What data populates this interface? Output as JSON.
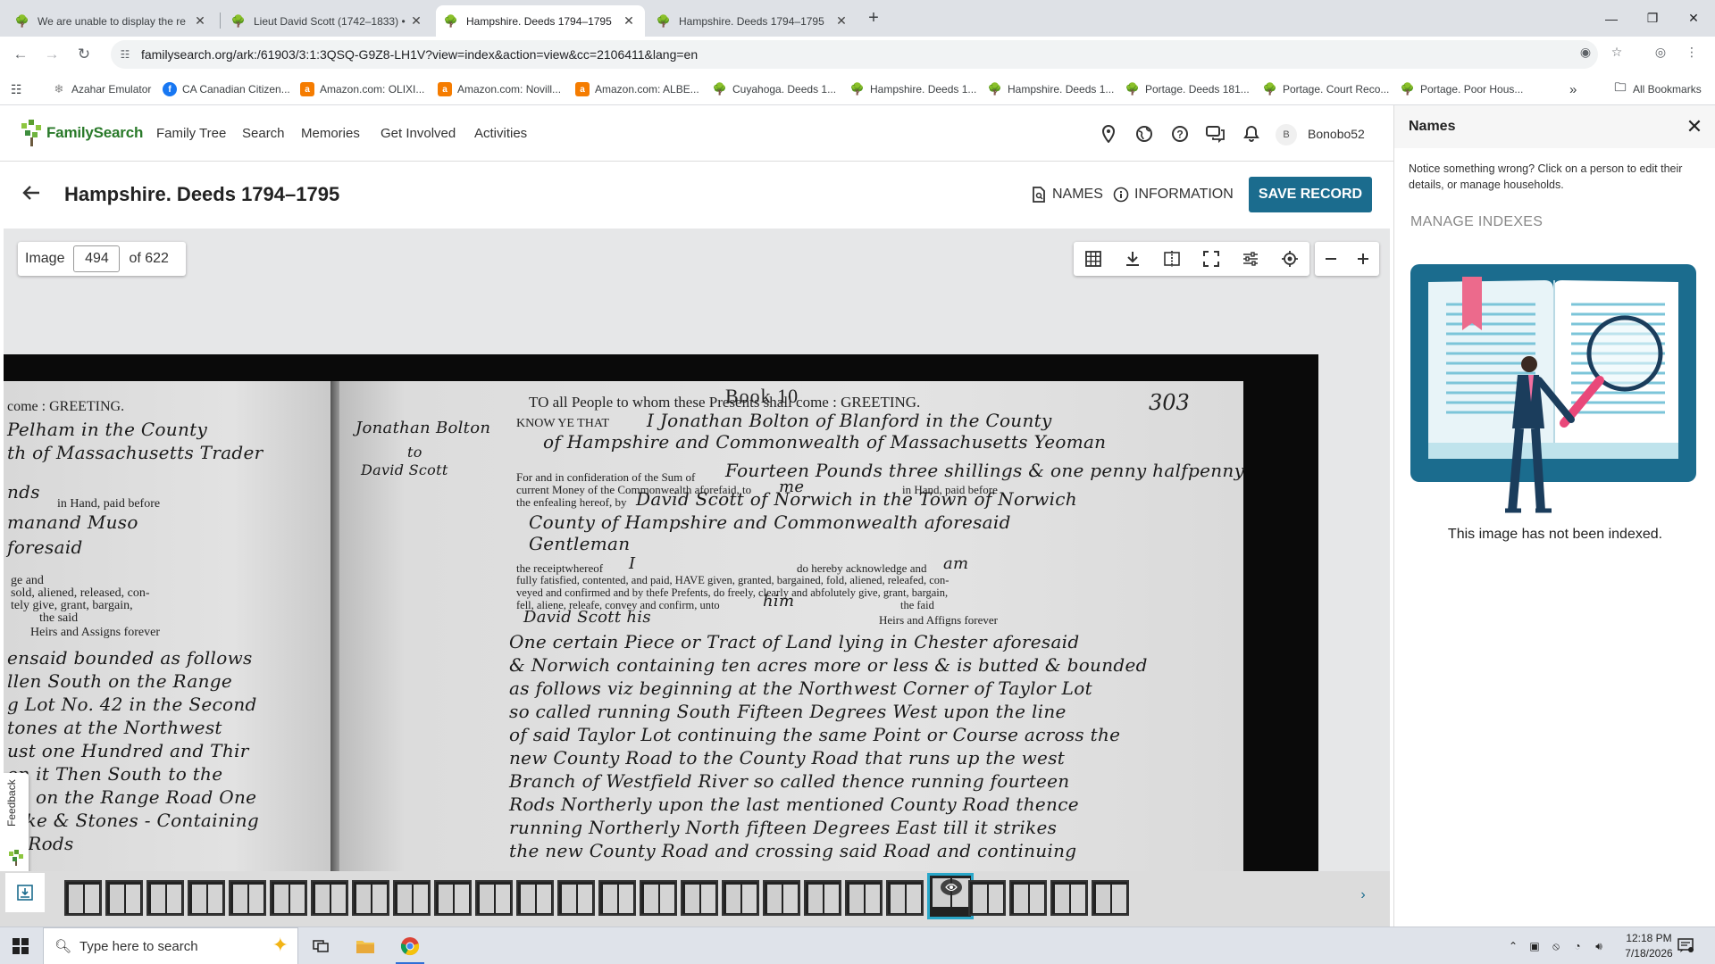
{
  "browser": {
    "tabs": [
      {
        "title": "We are unable to display the re"
      },
      {
        "title": "Lieut David Scott (1742–1833) •"
      },
      {
        "title": "Hampshire. Deeds 1794–1795"
      },
      {
        "title": "Hampshire. Deeds 1794–1795"
      }
    ],
    "url": "familysearch.org/ark:/61903/3:1:3QSQ-G9Z8-LH1V?view=index&action=view&cc=2106411&lang=en",
    "bookmarks": [
      {
        "label": "Azahar Emulator",
        "icon": "azahar-icon"
      },
      {
        "label": "CA Canadian Citizen...",
        "icon": "facebook-icon"
      },
      {
        "label": "Amazon.com: OLIXI...",
        "icon": "amazon-icon"
      },
      {
        "label": "Amazon.com: Novill...",
        "icon": "amazon-icon"
      },
      {
        "label": "Amazon.com: ALBE...",
        "icon": "amazon-icon"
      },
      {
        "label": "Cuyahoga. Deeds 1...",
        "icon": "familysearch-icon"
      },
      {
        "label": "Hampshire. Deeds 1...",
        "icon": "familysearch-icon"
      },
      {
        "label": "Hampshire. Deeds 1...",
        "icon": "familysearch-icon"
      },
      {
        "label": "Portage. Deeds 181...",
        "icon": "familysearch-icon"
      },
      {
        "label": "Portage. Court Reco...",
        "icon": "familysearch-icon"
      },
      {
        "label": "Portage. Poor Hous...",
        "icon": "familysearch-icon"
      }
    ],
    "all_bookmarks": "All Bookmarks",
    "overflow": "»"
  },
  "site": {
    "logo_text": "FamilySearch",
    "nav": [
      "Family Tree",
      "Search",
      "Memories",
      "Get Involved",
      "Activities"
    ],
    "avatar_initial": "B",
    "username": "Bonobo52"
  },
  "record": {
    "title": "Hampshire. Deeds 1794–1795",
    "names_label": "NAMES",
    "information_label": "INFORMATION",
    "save_label": "SAVE RECORD"
  },
  "viewer": {
    "image_label": "Image",
    "image_number": "494",
    "of_total": "of 622",
    "feedback_label": "Feedback",
    "tools": [
      "grid-icon",
      "download-icon",
      "compare-icon",
      "fullscreen-icon",
      "adjust-icon",
      "locate-icon",
      "zoom-out-icon",
      "zoom-in-icon"
    ]
  },
  "document": {
    "book": "Book 10",
    "page_number": "303",
    "left_page": [
      "come : GREETING.",
      "Pelham in the County",
      "th of Massachusetts Trader",
      "nds",
      "in Hand, paid before",
      "manand Muso",
      "foresaid",
      "ge and",
      "sold, aliened, released, con-",
      "tely give, grant, bargain,",
      "the said",
      "Heirs and Assigns forever",
      "ensaid bounded as follows",
      "llen South on the Range",
      "g Lot No. 42 in the Second",
      "tones at the Northwest",
      "ust one Hundred and Thir",
      "on it Then South to the",
      "en on the Range Road One",
      "take & Stones - Containing",
      "rl Rods"
    ],
    "margin_note": [
      "Jonathan Bolton",
      "to",
      "David Scott"
    ],
    "right_printed": [
      "TO all People to  whom these Presents shall come : GREETING.",
      "KNOW YE THAT",
      "For and in confideration  of the Sum of",
      "current Money of the Commonwealth aforefaid, to",
      "in Hand, paid before",
      "the enfealing hereof, by",
      "the receiptwhereof",
      "do hereby acknowledge and",
      "fully fatisfied, contented, and paid, HAVE given, granted, bargained, fold, aliened, releafed, con-",
      "veyed and confirmed and by thefe Prefents, do freely, clearly and abfolutely give,  grant,  bargain,",
      "fell, aliene, releafe, convey and confirm, unto",
      "the faid",
      "Heirs and Affigns forever"
    ],
    "right_script": [
      "I Jonathan Bolton of Blanford in the County",
      "of Hampshire and Commonwealth of Massachusetts Yeoman",
      "Fourteen Pounds three shillings & one penny halfpenny",
      "me",
      "David Scott of Norwich in the Town of Norwich",
      "County of Hampshire and Commonwealth aforesaid",
      "Gentleman",
      "I",
      "am",
      "him",
      "David Scott his",
      "One certain Piece or Tract of Land lying in Chester aforesaid",
      "& Norwich containing ten acres more or less & is butted & bounded",
      "as follows viz beginning at the Northwest Corner of Taylor Lot",
      "so called running South Fifteen Degrees West upon the line",
      "of said Taylor Lot continuing the same Point or Course across the",
      "new County Road to the County Road that runs up the west",
      "Branch of Westfield River so called thence running fourteen",
      "Rods Northerly upon the last mentioned County Road thence",
      "running Northerly North fifteen Degrees East till it strikes",
      "the new County Road and crossing said Road and continuing"
    ]
  },
  "names_panel": {
    "title": "Names",
    "notice": "Notice something wrong? Click on a person to edit their details, or manage households.",
    "manage": "MANAGE INDEXES",
    "empty_message": "This image has not been indexed."
  },
  "taskbar": {
    "search_placeholder": "Type here to search",
    "time": "12:18 PM",
    "date": "7/18/2026"
  },
  "colors": {
    "accent": "#1b6c8e",
    "brand_green": "#2a7a2a",
    "tab_bar": "#dee1e6",
    "viewer_bg": "#e6e7e8",
    "current_thumb": "#2aa7c9"
  }
}
